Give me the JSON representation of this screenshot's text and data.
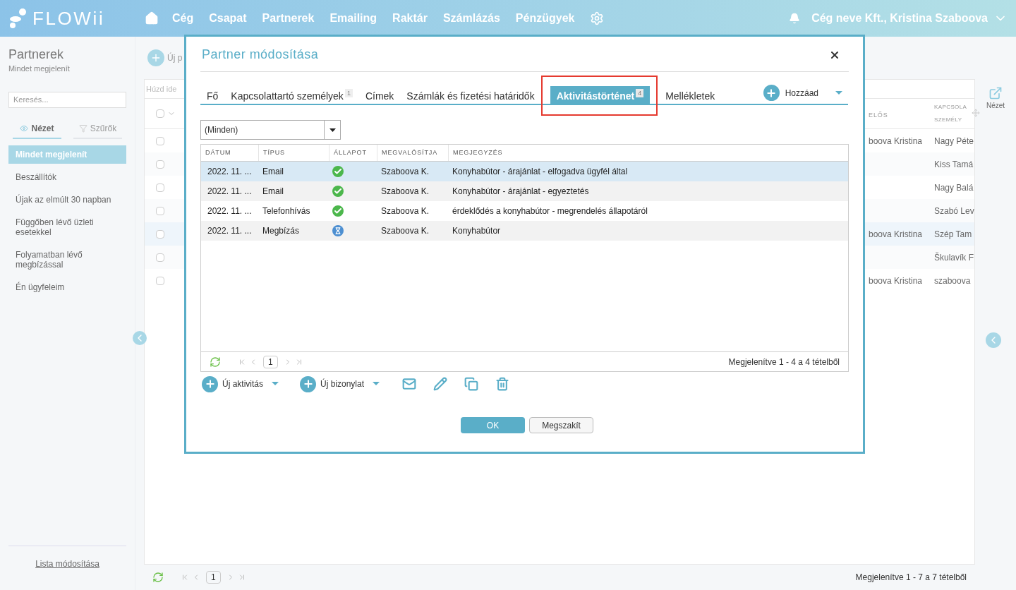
{
  "app": {
    "logo": "FLOWii",
    "nav": [
      {
        "label": "Cég"
      },
      {
        "label": "Csapat"
      },
      {
        "label": "Partnerek"
      },
      {
        "label": "Emailing"
      },
      {
        "label": "Raktár"
      },
      {
        "label": "Számlázás"
      },
      {
        "label": "Pénzügyek"
      }
    ],
    "user": "Cég neve Kft., Kristina Szaboova"
  },
  "sidebar": {
    "title": "Partnerek",
    "subtitle": "Mindet megjelenít",
    "search": {
      "placeholder": "Keresés..."
    },
    "tabs": [
      {
        "label": "Nézet",
        "selected": true
      },
      {
        "label": "Szűrők",
        "selected": false
      }
    ],
    "items": [
      {
        "label": "Mindet megjelenít",
        "selected": true
      },
      {
        "label": "Beszállítók",
        "selected": false
      },
      {
        "label": "Újak az elmúlt 30 napban",
        "selected": false
      },
      {
        "label": "Függőben lévő üzleti esetekkel",
        "selected": false
      },
      {
        "label": "Folyamatban lévő megbízással",
        "selected": false
      },
      {
        "label": "Én ügyfeleim",
        "selected": false
      }
    ],
    "footer_link": "Lista módosítása"
  },
  "toolbar": {
    "new_button": "Új p"
  },
  "grid": {
    "group_hint": "Húzd ide",
    "select_all_checked": false,
    "columns": [
      {
        "label": "ELŐS"
      },
      {
        "label": "KAPCSOLA SZEMÉLY"
      }
    ],
    "rows": [
      {
        "checked": false,
        "selected": false,
        "column_1": "boova Kristina",
        "column_2": "Nagy Péte"
      },
      {
        "checked": false,
        "selected": false,
        "column_2": "Kiss Tamá"
      },
      {
        "checked": false,
        "selected": false,
        "column_2": "Nagy Balá"
      },
      {
        "checked": false,
        "selected": false,
        "column_2": "Szabó Lev"
      },
      {
        "checked": false,
        "selected": true,
        "column_1": "boova Kristina",
        "column_2": "Szép Tam"
      },
      {
        "checked": false,
        "selected": false,
        "column_2": "Škulavík F"
      },
      {
        "checked": false,
        "selected": false,
        "column_1": "boova Kristina",
        "column_2": "szaboova"
      }
    ],
    "pager": {
      "page": "1",
      "summary": "Megjelenítve 1 - 7 a 7 tételből"
    }
  },
  "right_panel": {
    "view_label": "Nézet"
  },
  "dialog": {
    "title": "Partner módosítása",
    "tabs": [
      {
        "label": "Fő",
        "selected": false
      },
      {
        "label": "Kapcsolattartó személyek",
        "count": "1",
        "selected": false
      },
      {
        "label": "Címek",
        "selected": false
      },
      {
        "label": "Számlák és fizetési határidők",
        "selected": false
      },
      {
        "label": "Aktivitástörténet",
        "count": "4",
        "selected": true,
        "highlighted": true
      },
      {
        "label": "Mellékletek",
        "selected": false
      }
    ],
    "add_button": "Hozzáad",
    "filter": {
      "value": "(Minden)"
    },
    "table": {
      "columns": [
        "DÁTUM",
        "TÍPUS",
        "ÁLLAPOT",
        "MEGVALÓSÍTJA",
        "MEGJEGYZÉS"
      ],
      "rows": [
        {
          "date": "2022. 11. ...",
          "type": "Email",
          "kind": "done",
          "performer": "Szaboova K.",
          "note": "Konyhabútor - árajánlat - elfogadva ügyfél által",
          "selected": true
        },
        {
          "date": "2022. 11. ...",
          "type": "Email",
          "kind": "done",
          "performer": "Szaboova K.",
          "note": "Konyhabútor - árajánlat - egyeztetés",
          "selected": false
        },
        {
          "date": "2022. 11. ...",
          "type": "Telefonhívás",
          "kind": "done",
          "performer": "Szaboova K.",
          "note": "érdeklődés a konyhabútor - megrendelés állapotáról",
          "selected": false
        },
        {
          "date": "2022. 11. ...",
          "type": "Megbízás",
          "kind": "pending",
          "performer": "Szaboova K.",
          "note": "Konyhabútor",
          "selected": false
        }
      ]
    },
    "pager": {
      "page": "1",
      "summary": "Megjelenítve 1 - 4 a 4 tételből"
    },
    "actions": [
      {
        "label": "Új aktivitás"
      },
      {
        "label": "Új bizonylat"
      }
    ],
    "ok": "OK",
    "cancel": "Megszakít"
  }
}
